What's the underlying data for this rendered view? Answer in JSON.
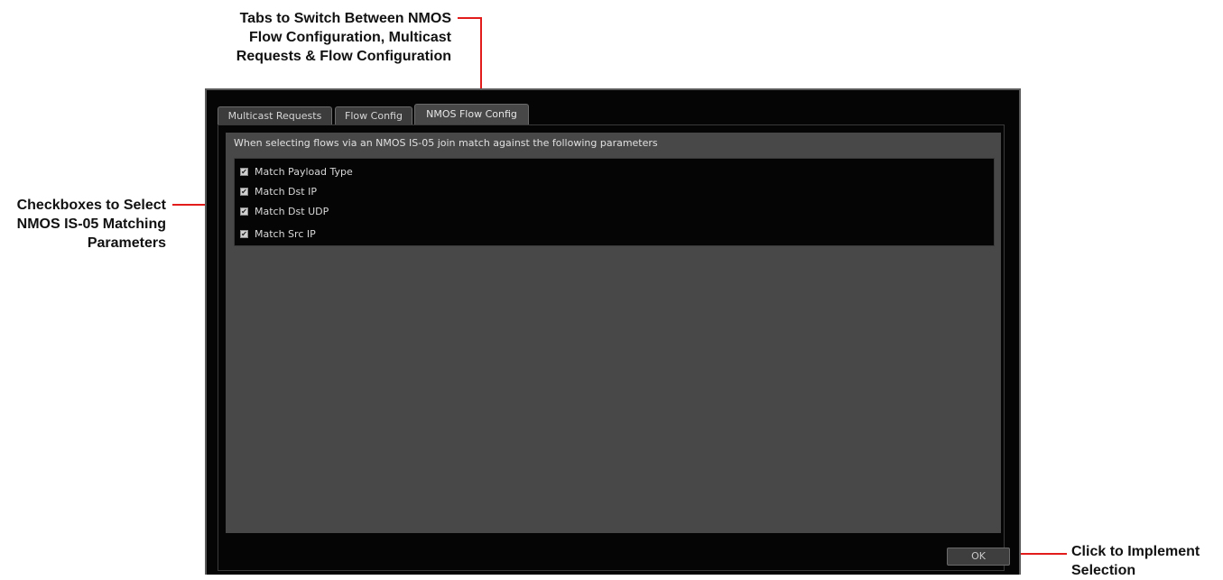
{
  "callouts": {
    "tabs": [
      "Tabs to Switch Between NMOS",
      "Flow Configuration,  Multicast",
      "Requests & Flow Configuration"
    ],
    "checkboxes": [
      "Checkboxes to Select",
      "NMOS IS-05 Matching",
      "Parameters"
    ],
    "ok": [
      "Click to Implement",
      "Selection"
    ]
  },
  "tabs": [
    {
      "label": "Multicast Requests",
      "active": false
    },
    {
      "label": "Flow Config",
      "active": false
    },
    {
      "label": "NMOS Flow Config",
      "active": true
    }
  ],
  "panel": {
    "description": "When selecting flows via an NMOS IS-05 join match against the following parameters",
    "checkboxes": [
      {
        "label": "Match Payload Type",
        "checked": true
      },
      {
        "label": "Match Dst IP",
        "checked": true
      },
      {
        "label": "Match Dst UDP",
        "checked": true
      },
      {
        "label": "Match Src IP",
        "checked": true
      }
    ]
  },
  "ok_label": "OK",
  "colors": {
    "annotation": "#e21b1b",
    "window_bg": "#050505",
    "panel_bg": "#484848"
  }
}
